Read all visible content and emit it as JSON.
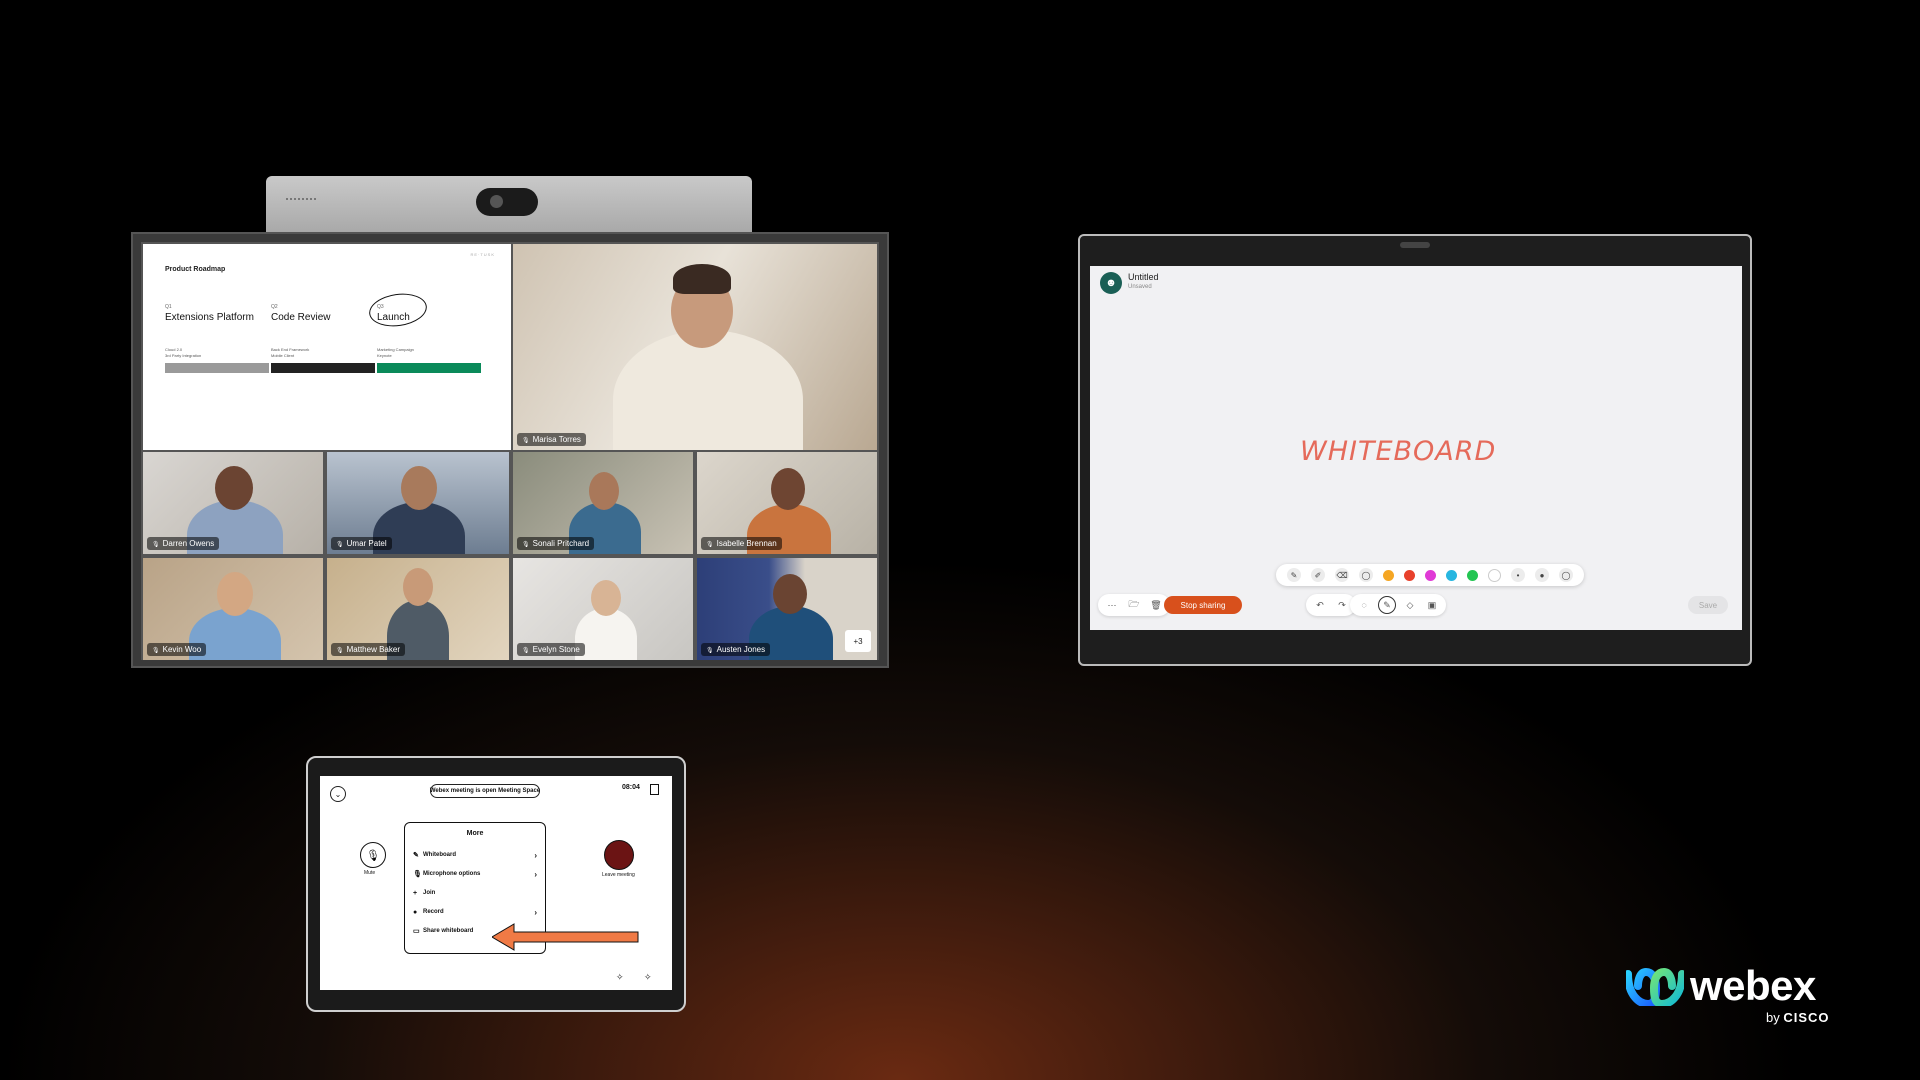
{
  "board": {
    "slide": {
      "title": "Product Roadmap",
      "watermark": "RE·TUSK",
      "columns": [
        {
          "quarter": "Q1",
          "heading": "Extensions Platform",
          "sub": "Cloud 2.0\n3rd Party Integration",
          "bar_color": "#9a9a9a"
        },
        {
          "quarter": "Q2",
          "heading": "Code Review",
          "sub": "Back End Framework\nMobile Client",
          "bar_color": "#222222"
        },
        {
          "quarter": "Q3",
          "heading": "Launch",
          "sub": "Marketing Campaign\nKeynote",
          "bar_color": "#0a8a5a"
        }
      ]
    },
    "participants": [
      {
        "name": "Marisa Torres"
      },
      {
        "name": "Darren Owens"
      },
      {
        "name": "Umar Patel"
      },
      {
        "name": "Sonali Pritchard"
      },
      {
        "name": "Isabelle Brennan"
      },
      {
        "name": "Kevin Woo"
      },
      {
        "name": "Matthew Baker"
      },
      {
        "name": "Evelyn Stone"
      },
      {
        "name": "Austen Jones"
      }
    ],
    "overflow_badge": "+3"
  },
  "whiteboard": {
    "doc_title": "Untitled",
    "doc_status": "Unsaved",
    "content_text": "WHITEBOARD",
    "colors": [
      "#f5a623",
      "#e8412c",
      "#e03ad6",
      "#27b6e0",
      "#23c552",
      "#ffffff"
    ],
    "stop_sharing_label": "Stop sharing",
    "save_label": "Save",
    "accent": "#d8501c"
  },
  "navigator": {
    "status_text": "Webex meeting is open Meeting Space",
    "time": "08:04",
    "mute_label": "Mute",
    "leave_label": "Leave meeting",
    "menu": {
      "title": "More",
      "items": [
        {
          "label": "Whiteboard",
          "icon": "✎",
          "arrow": "›"
        },
        {
          "label": "Microphone options",
          "icon": "🎙",
          "arrow": "›"
        },
        {
          "label": "Join",
          "icon": "+",
          "arrow": ""
        },
        {
          "label": "Record",
          "icon": "●",
          "arrow": "›"
        },
        {
          "label": "Share whiteboard",
          "icon": "▭",
          "arrow": ""
        }
      ]
    },
    "arrow_color": "#f07a45"
  },
  "brand": {
    "name": "webex",
    "by": "by",
    "company": "CISCO"
  }
}
